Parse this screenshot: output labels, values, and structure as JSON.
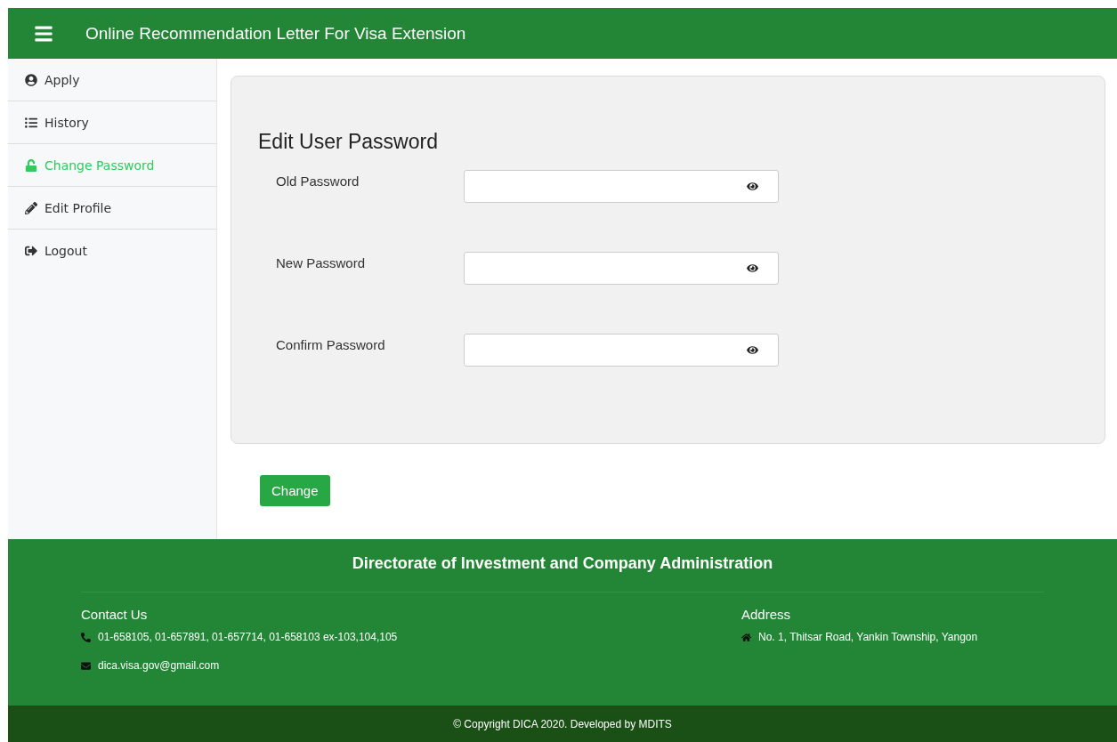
{
  "header": {
    "title": "Online Recommendation Letter For Visa Extension"
  },
  "sidebar": {
    "items": [
      {
        "label": "Apply",
        "selected": false
      },
      {
        "label": "History",
        "selected": false
      },
      {
        "label": "Change Password",
        "selected": true
      },
      {
        "label": "Edit Profile",
        "selected": false
      },
      {
        "label": "Logout",
        "selected": false
      }
    ]
  },
  "form": {
    "title": "Edit User Password",
    "fields": [
      {
        "label": "Old Password"
      },
      {
        "label": "New Password"
      },
      {
        "label": "Confirm Password"
      }
    ],
    "submit": "Change"
  },
  "footer": {
    "title": "Directorate of Investment and Company Administration",
    "contact": {
      "heading": "Contact Us",
      "phone": "01-658105, 01-657891, 01-657714, 01-658103 ex-103,104,105",
      "email": "dica.visa.gov@gmail.com"
    },
    "address": {
      "heading": "Address",
      "text": "No. 1, Thitsar Road, Yankin Township, Yangon"
    },
    "copyright": "© Copyright DICA 2020. Developed by MDITS"
  }
}
